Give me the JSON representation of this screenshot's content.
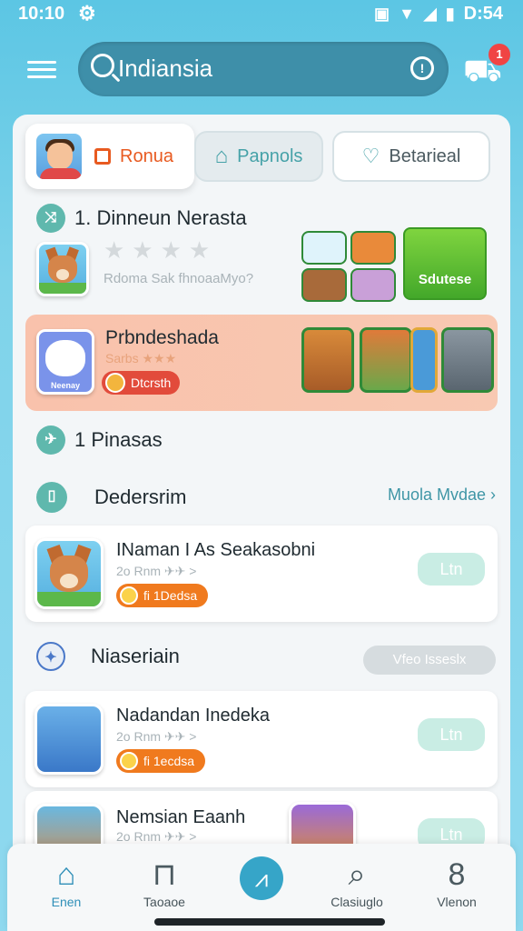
{
  "status_bar": {
    "time": "10:10",
    "right_time": "D:54"
  },
  "search": {
    "value": "Indiansia",
    "cart_badge": "1"
  },
  "tabs": [
    {
      "label": "Ronua"
    },
    {
      "label": "Papnols"
    },
    {
      "label": "Betarieal"
    }
  ],
  "section1": {
    "title": "1. Dinneun Nerasta",
    "ghost_text": "Rdoma Sak fhnoaaMyo?",
    "green_tile": "Sdutese"
  },
  "featured": {
    "title": "Prbndeshada",
    "subtitle": "Sarbs ★★★",
    "badge": "Dtcrsth",
    "icon_label": "Neenay"
  },
  "section2": {
    "title": "1 Pinasas"
  },
  "section3": {
    "title": "Dedersrim",
    "see_all": "Muola Mvdae ›"
  },
  "items": [
    {
      "title": "INaman I As Seakasobni",
      "sub": "2o Rnm ✈✈ >",
      "pill": "fi 1Dedsa",
      "get": "Ltn"
    },
    {
      "title": "Nadandan Inedeka",
      "sub": "2o Rnm ✈✈ >",
      "pill": "fi 1ecdsa",
      "get": "Ltn"
    },
    {
      "title": "Nemsian Eaanh",
      "sub": "2o Rnm ✈✈ >",
      "get": "Ltn"
    }
  ],
  "section4": {
    "title": "Niaseriain",
    "filter": "Vfeo Isseslx"
  },
  "nav": [
    {
      "label": "Enen",
      "icon": "home-icon"
    },
    {
      "label": "Taoaoe",
      "icon": "cup-icon"
    },
    {
      "label": "",
      "icon": "chart-icon"
    },
    {
      "label": "Clasiuglo",
      "icon": "search-icon"
    },
    {
      "label": "Vlenon",
      "icon": "profile-icon"
    }
  ],
  "colors": {
    "accent": "#36a5c8",
    "background": "#5cc6e4",
    "orange": "#f07a1e",
    "featured": "#f9c2ac"
  }
}
